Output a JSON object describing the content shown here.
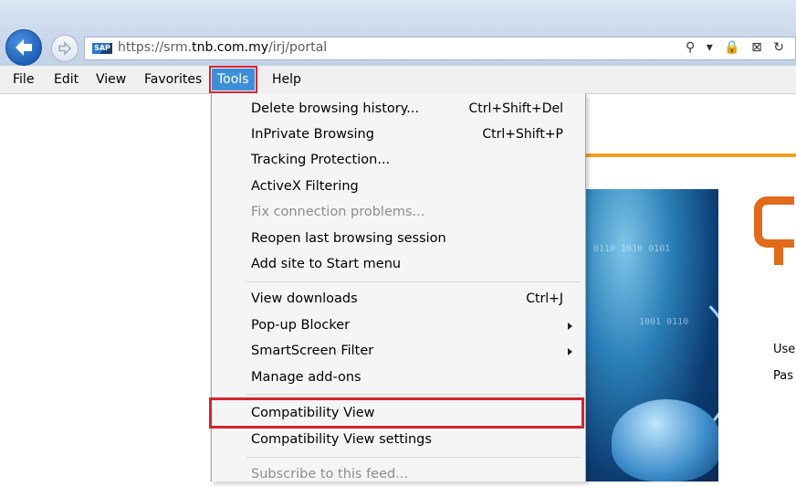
{
  "browser": {
    "url_prefix": "https://srm.",
    "url_domain": "tnb.com.my",
    "url_path": "/irj/portal",
    "sap_badge": "SAP",
    "address_icons": "⚲ ▾ 🔒 ⊠ ↻"
  },
  "menubar": {
    "items": [
      "File",
      "Edit",
      "View",
      "Favorites",
      "Tools",
      "Help"
    ]
  },
  "tools_menu": {
    "items": [
      {
        "label": "Delete browsing history...",
        "shortcut": "Ctrl+Shift+Del"
      },
      {
        "label": "InPrivate Browsing",
        "shortcut": "Ctrl+Shift+P"
      },
      {
        "label": "Tracking Protection...",
        "shortcut": ""
      },
      {
        "label": "ActiveX Filtering",
        "shortcut": ""
      },
      {
        "label": "Fix connection problems...",
        "shortcut": "",
        "disabled": true
      },
      {
        "label": "Reopen last browsing session",
        "shortcut": ""
      },
      {
        "label": "Add site to Start menu",
        "shortcut": ""
      },
      {
        "label": "View downloads",
        "shortcut": "Ctrl+J"
      },
      {
        "label": "Pop-up Blocker",
        "shortcut": "",
        "submenu": true
      },
      {
        "label": "SmartScreen Filter",
        "shortcut": "",
        "submenu": true
      },
      {
        "label": "Manage add-ons",
        "shortcut": ""
      },
      {
        "label": "Compatibility View",
        "shortcut": ""
      },
      {
        "label": "Compatibility View settings",
        "shortcut": ""
      },
      {
        "label": "Subscribe to this feed...",
        "shortcut": "",
        "disabled": true
      }
    ]
  },
  "page": {
    "user_label": "Use",
    "pass_label": "Pas"
  },
  "colors": {
    "highlight": "#d7232f",
    "menu_selected": "#3e8fd9",
    "orange_rule": "#f0a020"
  }
}
